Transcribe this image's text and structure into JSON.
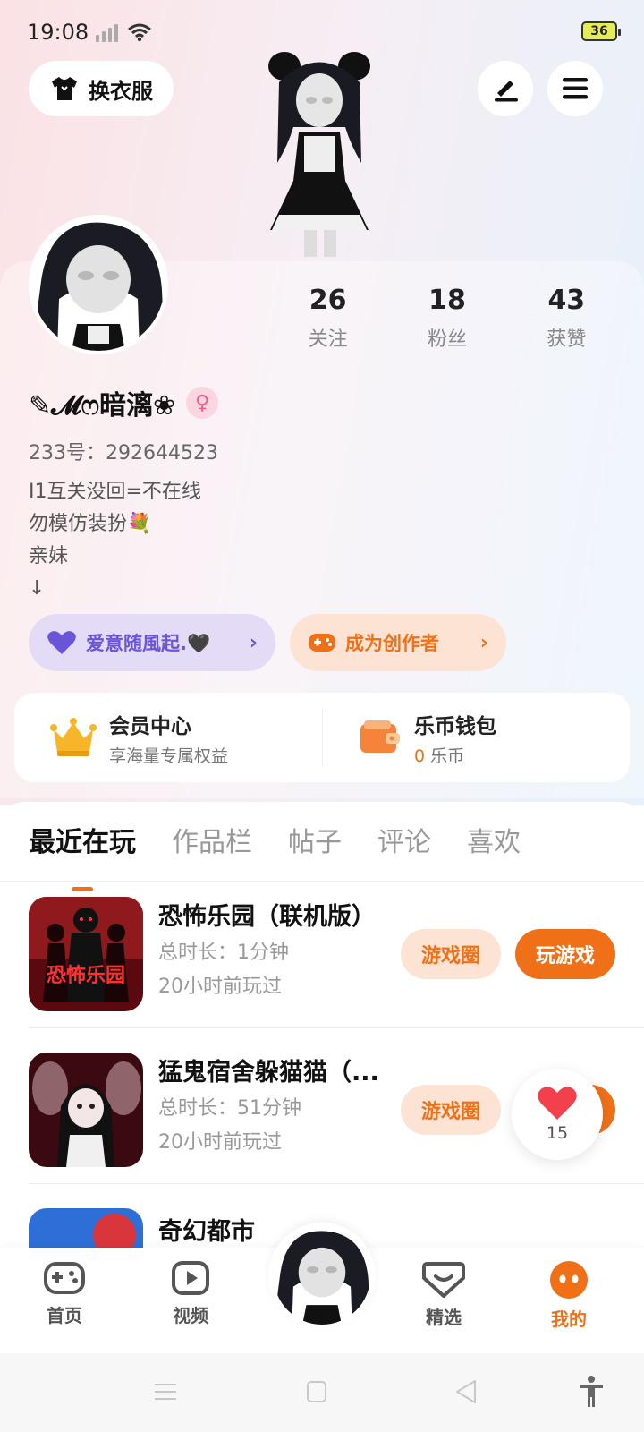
{
  "status_bar": {
    "time": "19:08",
    "battery": "36"
  },
  "header": {
    "outfit_label": "换衣服",
    "edit_icon": "pencil-icon",
    "menu_icon": "menu-icon"
  },
  "profile": {
    "stats": [
      {
        "value": "26",
        "label": "关注"
      },
      {
        "value": "18",
        "label": "粉丝"
      },
      {
        "value": "43",
        "label": "获赞"
      }
    ],
    "nickname": "✎𝓜ෆ暗漓❀",
    "gender": "♀",
    "uid": "233号：292644523",
    "bio": [
      "I1互关没回=不在线",
      "勿模仿装扮💐",
      "亲妹",
      "↓"
    ]
  },
  "pills": {
    "love_label": "爱意随風起.🖤",
    "creator_label": "成为创作者"
  },
  "vip": {
    "title": "会员中心",
    "subtitle": "享海量专属权益",
    "wallet_title": "乐币钱包",
    "wallet_amount": "0",
    "wallet_unit": "乐币"
  },
  "tabs": [
    "最近在玩",
    "作品栏",
    "帖子",
    "评论",
    "喜欢"
  ],
  "games": [
    {
      "title": "恐怖乐园（联机版）",
      "duration": "总时长：1分钟",
      "last_played": "20小时前玩过",
      "thumb_text": "恐怖乐园"
    },
    {
      "title": "猛鬼宿舍躲猫猫（...",
      "duration": "总时长：51分钟",
      "last_played": "20小时前玩过",
      "thumb_text": ""
    }
  ],
  "game_buttons": {
    "circle": "游戏圈",
    "play": "玩游戏"
  },
  "partial_row_title": "奇幻都市",
  "like_count": "15",
  "nav": [
    {
      "label": "首页",
      "icon": "gamepad-icon"
    },
    {
      "label": "视频",
      "icon": "video-icon"
    },
    {
      "label": "精选",
      "icon": "heart-chat-icon"
    },
    {
      "label": "我的",
      "icon": "face-icon"
    }
  ],
  "colors": {
    "accent": "#f07018",
    "love": "#6a55d8"
  }
}
